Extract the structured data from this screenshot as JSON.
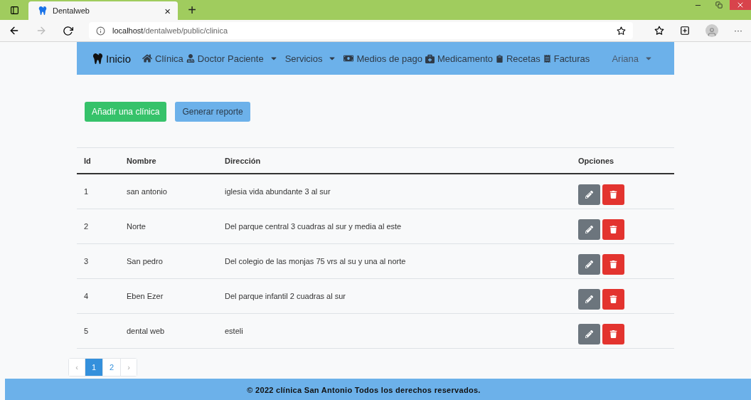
{
  "browser": {
    "tab_title": "Dentalweb",
    "tab_close": "×",
    "new_tab": "+",
    "url_host": "localhost",
    "url_path": "/dentalweb/public/clinica",
    "more": "···"
  },
  "navbar": {
    "brand": {
      "label": "Inicio"
    },
    "items": [
      {
        "label": "Clínica",
        "dropdown": false
      },
      {
        "label": "Doctor",
        "dropdown": false
      },
      {
        "label": "Paciente",
        "dropdown": true
      },
      {
        "label": "Servicios",
        "dropdown": true
      },
      {
        "label": "Medios de pago",
        "dropdown": false
      },
      {
        "label": "Medicamento",
        "dropdown": false
      },
      {
        "label": "Recetas",
        "dropdown": false
      },
      {
        "label": "Facturas",
        "dropdown": false
      }
    ],
    "user": {
      "label": "Ariana",
      "dropdown": true
    }
  },
  "actions": [
    {
      "label": "Añadir una clínica",
      "kind": "success"
    },
    {
      "label": "Generar reporte",
      "kind": "info"
    }
  ],
  "table": {
    "columns": [
      "Id",
      "Nombre",
      "Dirección",
      "Opciones"
    ],
    "rows": [
      {
        "id": "1",
        "name": "san antonio",
        "address": "iglesia vida abundante 3 al sur"
      },
      {
        "id": "2",
        "name": "Norte",
        "address": "Del parque central 3 cuadras al sur y media al este"
      },
      {
        "id": "3",
        "name": "San pedro",
        "address": "Del colegio de las monjas 75 vrs al su y una al norte"
      },
      {
        "id": "4",
        "name": "Eben Ezer",
        "address": "Del parque infantil 2 cuadras al sur"
      },
      {
        "id": "5",
        "name": "dental web",
        "address": "esteli"
      }
    ]
  },
  "pagination": {
    "prev": "‹",
    "pages": [
      {
        "label": "1",
        "selected": true
      },
      {
        "label": "2",
        "selected": false
      }
    ],
    "next": "›"
  },
  "footer": "© 2022 clínica San Antonio Todos los derechos reservados."
}
